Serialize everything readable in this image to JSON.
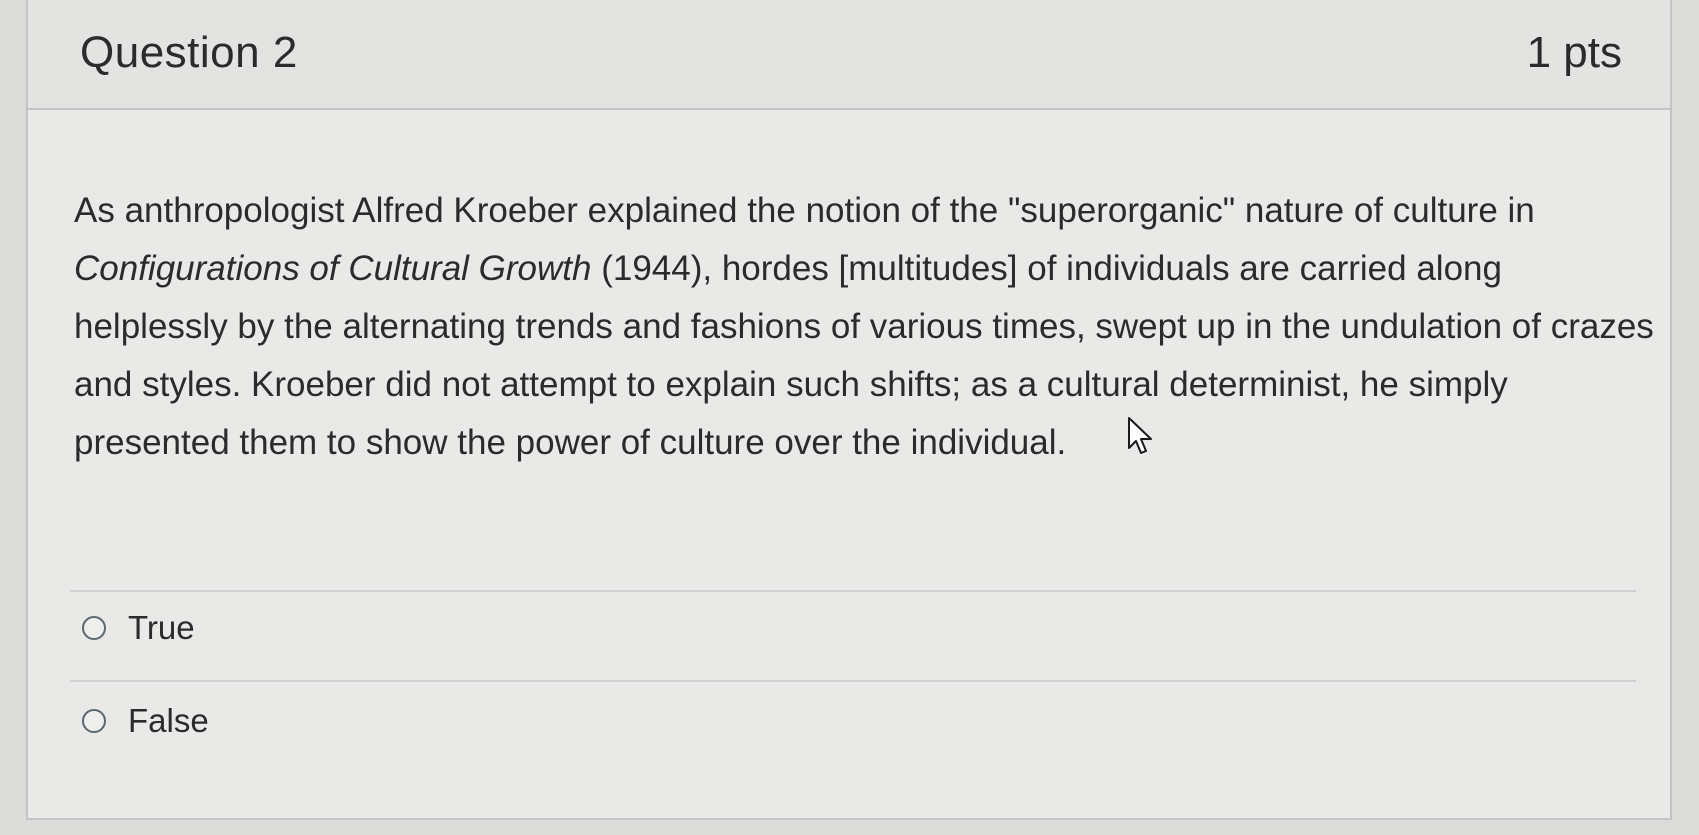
{
  "question": {
    "title": "Question 2",
    "points": "1 pts",
    "text_part1": "As anthropologist Alfred Kroeber explained the notion of the \"superorganic\" nature of culture in ",
    "text_italic": "Configurations of Cultural Growth",
    "text_part2": " (1944), hordes [multitudes] of individuals are carried along helplessly by the alternating trends and fashions of various times, swept up in the undulation of crazes and styles.  Kroeber did not attempt to explain such shifts; as a cultural determinist, he simply presented them to show the power of culture over the individual."
  },
  "answers": [
    {
      "label": "True",
      "selected": false
    },
    {
      "label": "False",
      "selected": false
    }
  ],
  "icons": {
    "radio": "radio-unselected-icon",
    "cursor": "mouse-pointer-icon"
  },
  "colors": {
    "background": "#dcdcda",
    "card": "#e9e9e7",
    "header": "#e3e3e1",
    "border": "#c3c5c4",
    "text": "#2b2b2b"
  }
}
